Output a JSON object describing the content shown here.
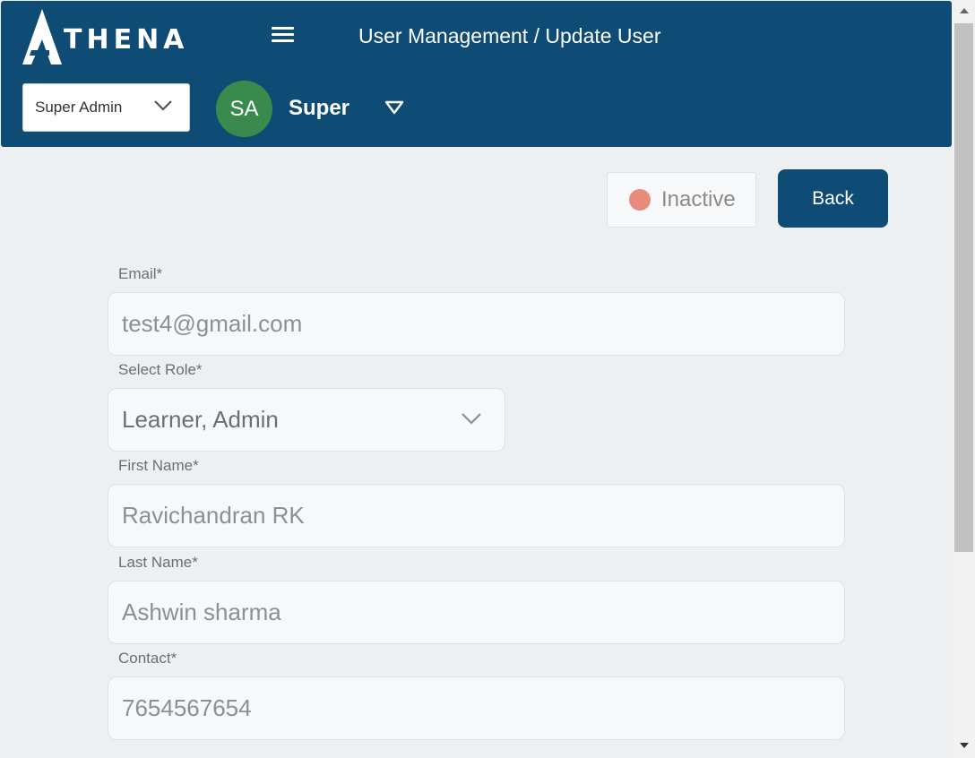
{
  "header": {
    "logo_text": "THENA",
    "logo_letter": "A",
    "breadcrumb": "User Management / Update User",
    "role_selector": {
      "value": "Super Admin"
    },
    "avatar_initials": "SA",
    "user_name": "Super"
  },
  "status": {
    "label": "Inactive",
    "dot_color": "#e88a7c"
  },
  "actions": {
    "back_label": "Back"
  },
  "form": {
    "email": {
      "label": "Email*",
      "value": "test4@gmail.com"
    },
    "role": {
      "label": "Select Role*",
      "value": "Learner, Admin"
    },
    "first_name": {
      "label": "First Name*",
      "value": "Ravichandran RK"
    },
    "last_name": {
      "label": "Last Name*",
      "value": "Ashwin sharma"
    },
    "contact": {
      "label": "Contact*",
      "value": "7654567654"
    }
  },
  "colors": {
    "brand": "#0f4c75",
    "avatar": "#3a8a4e",
    "background": "#eeeff1"
  },
  "icons": [
    "hamburger-menu-icon",
    "chevron-down-icon",
    "caret-down-outline-icon",
    "scroll-up-arrow-icon",
    "scroll-down-arrow-icon"
  ]
}
